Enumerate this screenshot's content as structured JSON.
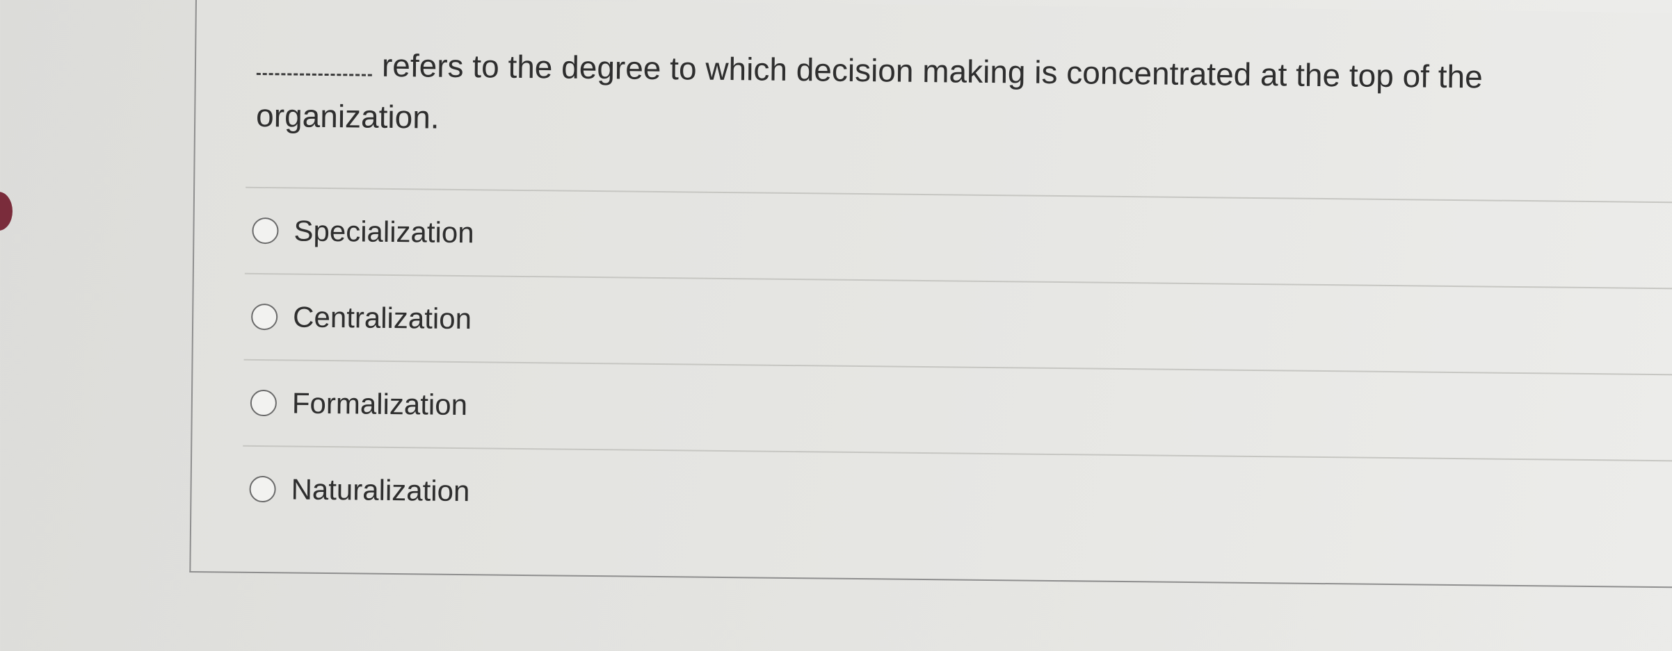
{
  "question": {
    "prompt": "refers to the degree to which decision making is concentrated at the top of the organization."
  },
  "answers": [
    {
      "label": "Specialization",
      "selected": false
    },
    {
      "label": "Centralization",
      "selected": false
    },
    {
      "label": "Formalization",
      "selected": false
    },
    {
      "label": "Naturalization",
      "selected": false
    }
  ],
  "colors": {
    "background": "#e3e3e0",
    "text": "#2e2e2e",
    "border": "#8e8e8e",
    "divider": "#c6c6c2",
    "side_marker": "#7a2c3b"
  }
}
